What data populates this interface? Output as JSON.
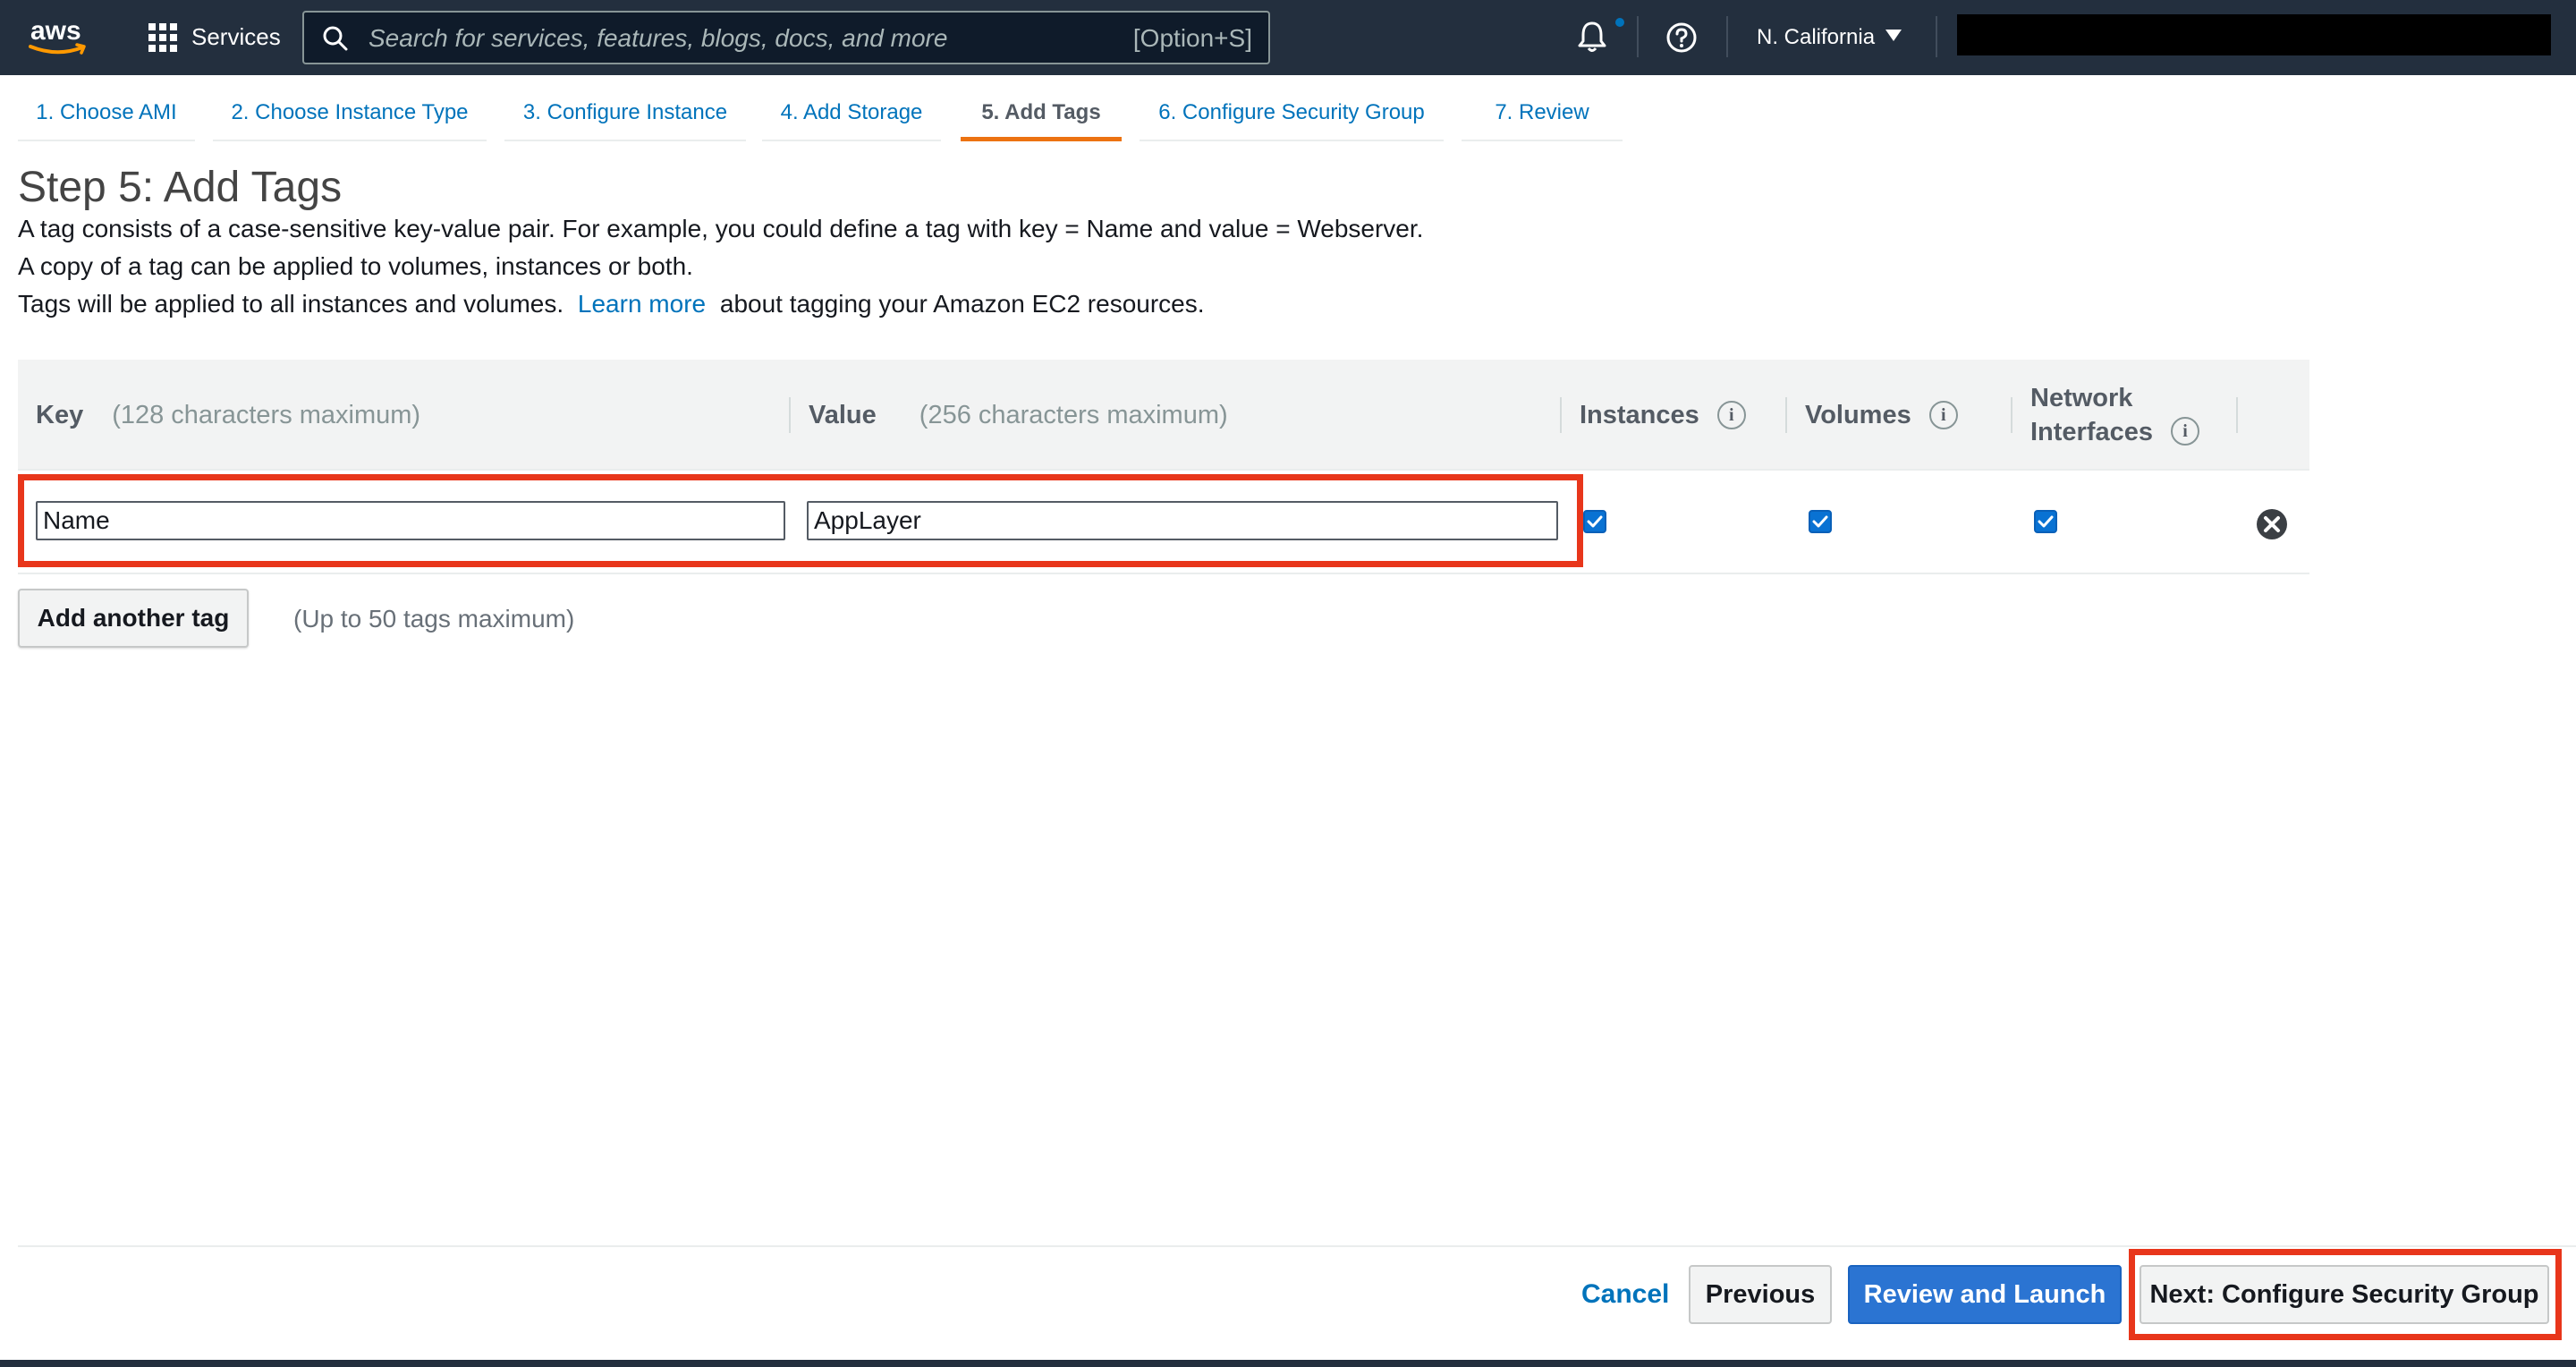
{
  "nav": {
    "logo": "aws",
    "services_label": "Services",
    "search_placeholder": "Search for services, features, blogs, docs, and more",
    "search_shortcut": "[Option+S]",
    "region": "N. California",
    "icons": [
      "grid-icon",
      "search-icon",
      "bell-icon",
      "help-icon",
      "caret-down-icon"
    ]
  },
  "wizard": {
    "tabs": [
      {
        "label": "1. Choose AMI",
        "active": false
      },
      {
        "label": "2. Choose Instance Type",
        "active": false
      },
      {
        "label": "3. Configure Instance",
        "active": false
      },
      {
        "label": "4. Add Storage",
        "active": false
      },
      {
        "label": "5. Add Tags",
        "active": true
      },
      {
        "label": "6. Configure Security Group",
        "active": false
      },
      {
        "label": "7. Review",
        "active": false
      }
    ]
  },
  "step": {
    "title": "Step 5: Add Tags",
    "line1": "A tag consists of a case-sensitive key-value pair. For example, you could define a tag with key = Name and value = Webserver.",
    "line2": "A copy of a tag can be applied to volumes, instances or both.",
    "line3_before": "Tags will be applied to all instances and volumes.",
    "learn_more": "Learn more",
    "line3_after": "about tagging your Amazon EC2 resources."
  },
  "table": {
    "headers": {
      "key": "Key",
      "key_hint": "(128 characters maximum)",
      "value": "Value",
      "value_hint": "(256 characters maximum)",
      "instances": "Instances",
      "volumes": "Volumes",
      "network_line1": "Network",
      "network_line2": "Interfaces",
      "info_symbol": "i"
    },
    "rows": [
      {
        "key": "Name",
        "value": "AppLayer",
        "instances": true,
        "volumes": true,
        "network_interfaces": true
      }
    ],
    "add_button": "Add another tag",
    "max_note": "(Up to 50 tags maximum)"
  },
  "footer": {
    "cancel": "Cancel",
    "previous": "Previous",
    "review_and_launch": "Review and Launch",
    "next": "Next: Configure Security Group"
  },
  "colors": {
    "nav_bg": "#232f3e",
    "link": "#0073bb",
    "active_tab": "#ec7211",
    "primary_button": "#2b74d2",
    "highlight": "#e8361b"
  }
}
